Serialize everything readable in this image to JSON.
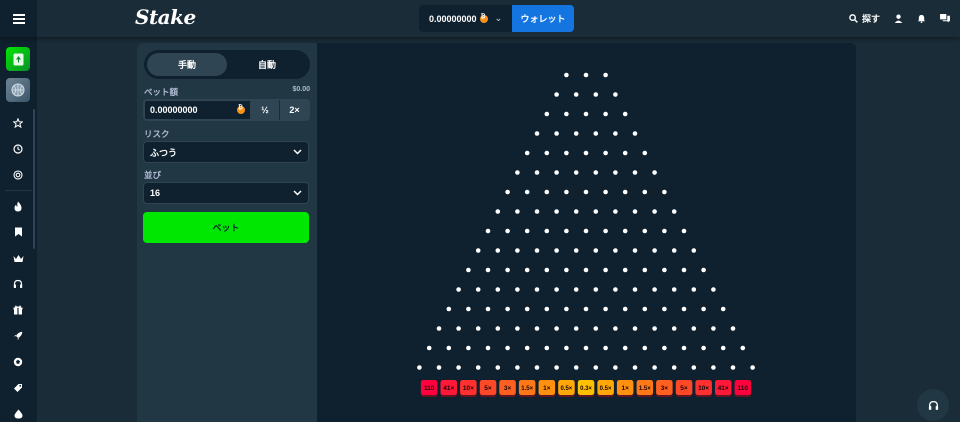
{
  "header": {
    "logo": "Stake",
    "balance": "0.00000000",
    "wallet_label": "ウォレット",
    "search_label": "探す"
  },
  "panel": {
    "tabs": [
      {
        "label": "手動",
        "active": true
      },
      {
        "label": "自動",
        "active": false
      }
    ],
    "bet_amount_label": "ベット額",
    "bet_amount_usd": "$0.00",
    "bet_amount_value": "0.00000000",
    "half_label": "½",
    "double_label": "2×",
    "risk_label": "リスク",
    "risk_value": "ふつう",
    "rows_label": "並び",
    "rows_value": "16",
    "bet_button": "ベット"
  },
  "game": {
    "rows": 16,
    "multipliers": [
      "110",
      "41×",
      "10×",
      "5×",
      "3×",
      "1.5×",
      "1×",
      "0.5×",
      "0.3×",
      "0.5×",
      "1×",
      "1.5×",
      "3×",
      "5×",
      "10×",
      "41×",
      "110"
    ],
    "bucket_colors": [
      "#ff003f",
      "#ff1837",
      "#ff302f",
      "#ff4827",
      "#ff6020",
      "#ff7818",
      "#ff9010",
      "#ffa808",
      "#ffc000",
      "#ffa808",
      "#ff9010",
      "#ff7818",
      "#ff6020",
      "#ff4827",
      "#ff302f",
      "#ff1837",
      "#ff003f"
    ]
  },
  "colors": {
    "accent_green": "#00e701",
    "accent_blue": "#1475e1",
    "bg_dark": "#0f212e",
    "bg_mid": "#1a2c38",
    "panel": "#213743"
  },
  "sidebar": {
    "icons": [
      "star-icon",
      "clock-icon",
      "target-icon",
      "flame-icon",
      "bookmark-icon",
      "crown-icon",
      "headset-icon",
      "gift-icon",
      "rocket-icon",
      "ball-icon",
      "tag-icon",
      "drop-icon"
    ]
  }
}
